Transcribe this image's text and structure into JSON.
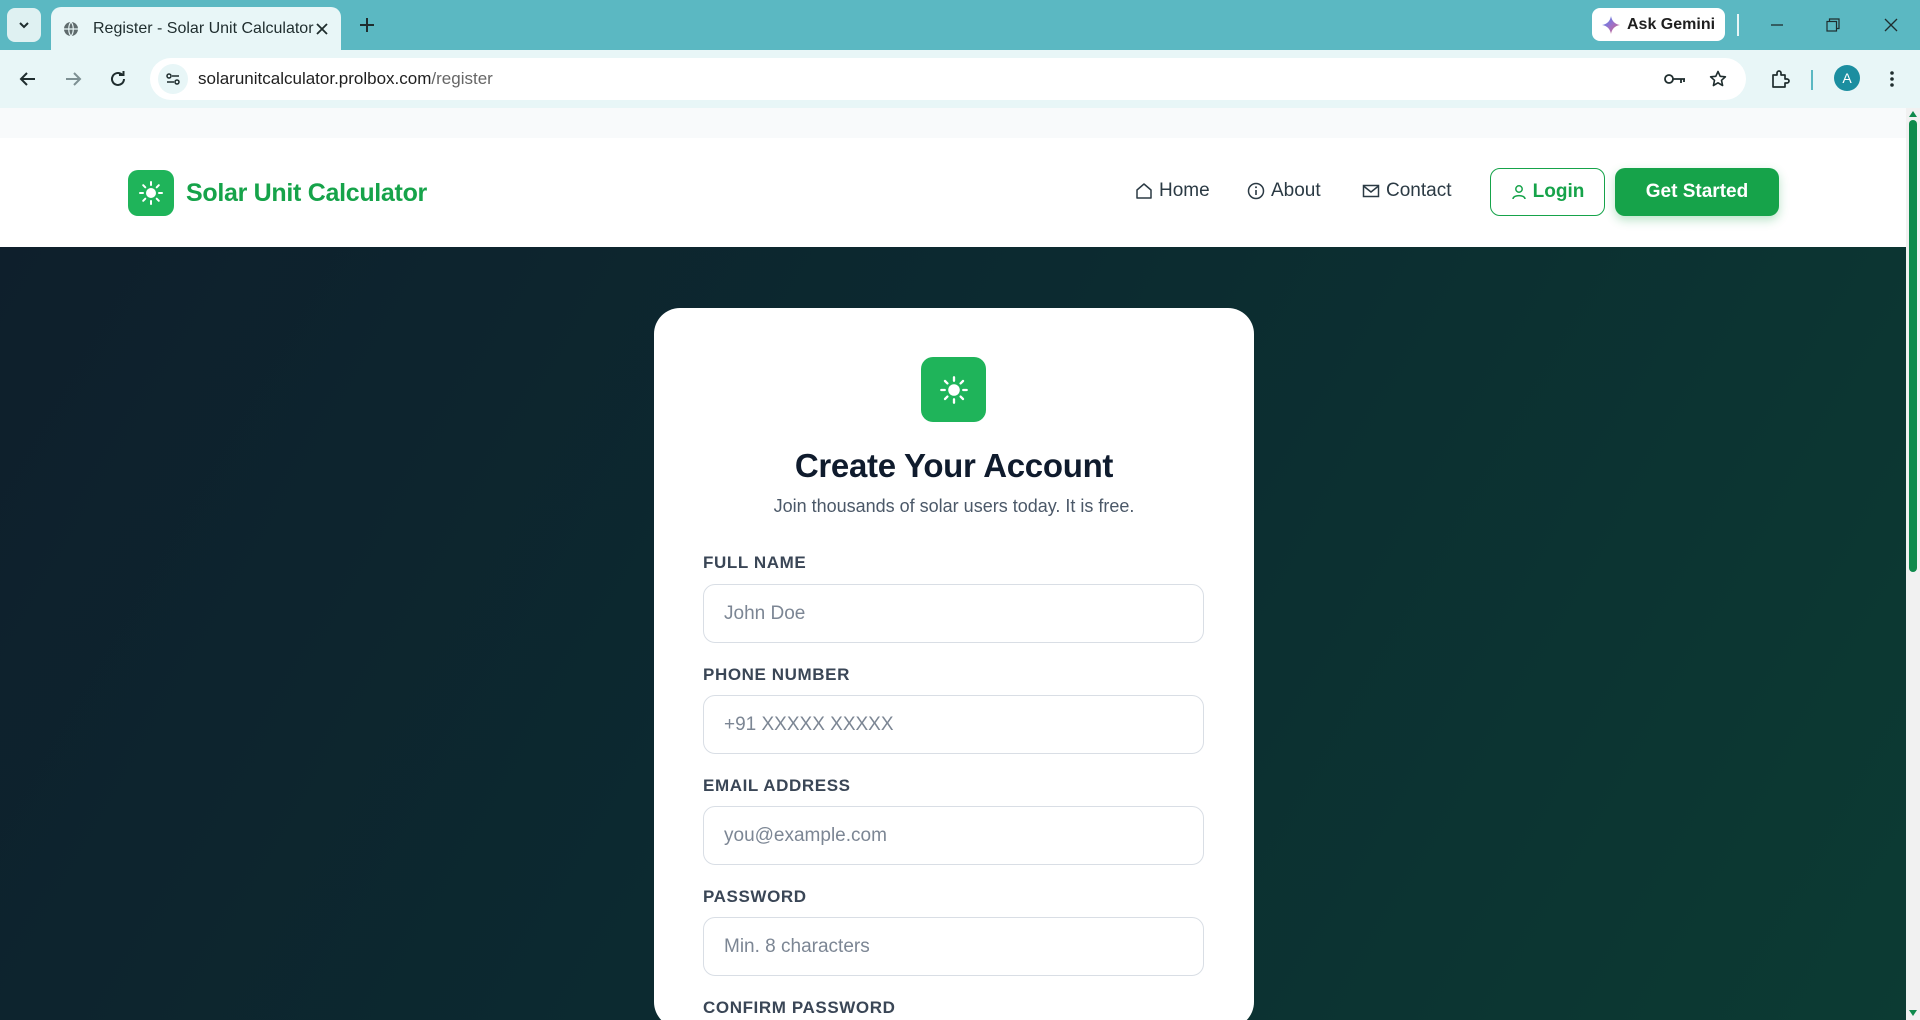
{
  "browser": {
    "tab_title": "Register - Solar Unit Calculator",
    "url_host": "solarunitcalculator.prolbox.com",
    "url_path": "/register",
    "ask_gemini": "Ask Gemini",
    "profile_initial": "A"
  },
  "header": {
    "brand_name": "Solar Unit Calculator",
    "nav": {
      "home": "Home",
      "about": "About",
      "contact": "Contact"
    },
    "login": "Login",
    "get_started": "Get Started"
  },
  "colors": {
    "brand_green": "#16a34a",
    "icon_green": "#1fb45a",
    "hero_dark": "#0e1f2c",
    "hero_teal": "#0c3b33",
    "chrome_teal": "#5bb8c2"
  },
  "form": {
    "title": "Create Your Account",
    "subtitle": "Join thousands of solar users today. It is free.",
    "fields": [
      {
        "label": "FULL NAME",
        "placeholder": "John Doe",
        "value": ""
      },
      {
        "label": "PHONE NUMBER",
        "placeholder": "+91 XXXXX XXXXX",
        "value": ""
      },
      {
        "label": "EMAIL ADDRESS",
        "placeholder": "you@example.com",
        "value": ""
      },
      {
        "label": "PASSWORD",
        "placeholder": "Min. 8 characters",
        "value": ""
      },
      {
        "label": "CONFIRM PASSWORD"
      }
    ]
  },
  "icons": {
    "favicon": "globe-icon",
    "brand": "sun-icon",
    "home": "home-icon",
    "about": "info-icon",
    "contact": "mail-icon",
    "login": "user-icon"
  }
}
